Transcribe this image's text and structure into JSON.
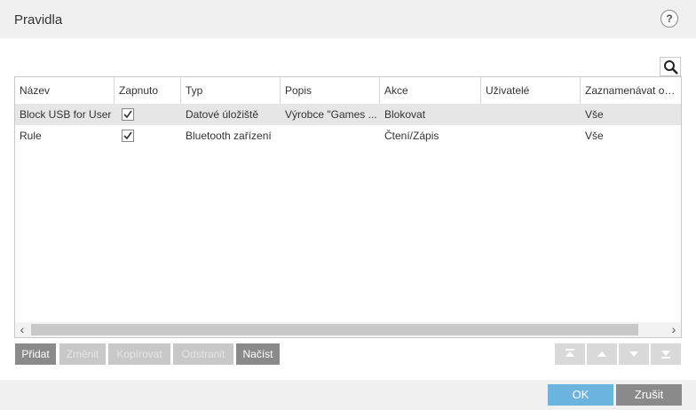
{
  "window": {
    "title": "Pravidla",
    "help_label": "?"
  },
  "table": {
    "columns": [
      "Název",
      "Zapnuto",
      "Typ",
      "Popis",
      "Akce",
      "Uživatelé",
      "Zaznamenávat od ..."
    ],
    "rows": [
      {
        "name": "Block USB for User",
        "enabled": true,
        "type": "Datové úložiště",
        "description": "Výrobce \"Games ...",
        "action": "Blokovat",
        "users": "",
        "log_from": "Vše",
        "selected": true
      },
      {
        "name": "Rule",
        "enabled": true,
        "type": "Bluetooth zařízení",
        "description": "",
        "action": "Čtení/Zápis",
        "users": "",
        "log_from": "Vše",
        "selected": false
      }
    ]
  },
  "toolbar": {
    "add": "Přidat",
    "edit": "Změnit",
    "copy": "Kopírovat",
    "remove": "Odstranit",
    "load": "Načíst"
  },
  "move_buttons": [
    "move-top-icon",
    "move-up-icon",
    "move-down-icon",
    "move-bottom-icon"
  ],
  "footer": {
    "ok": "OK",
    "cancel": "Zrušit"
  },
  "colors": {
    "ok_blue": "#6cb4e0",
    "active_gray": "#8a8a8a",
    "disabled_gray": "#c8c8c8"
  }
}
